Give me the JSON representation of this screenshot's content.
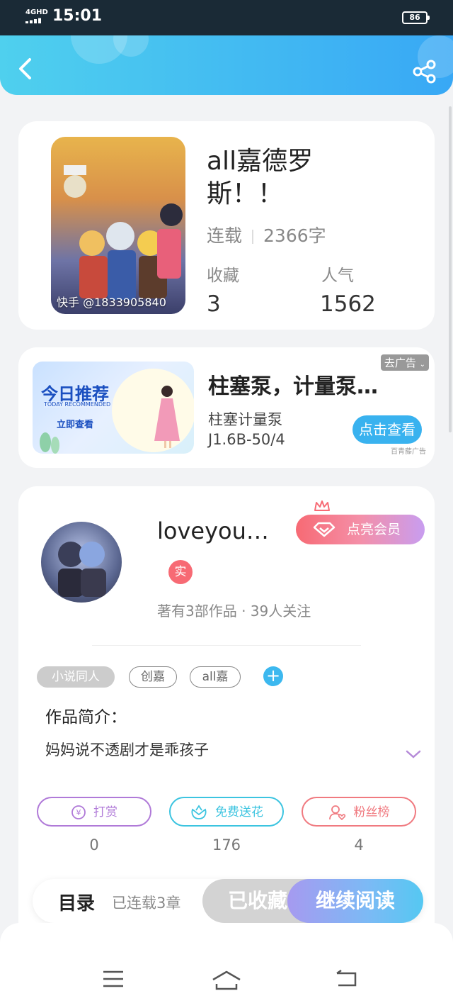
{
  "status_bar": {
    "network": "4GHD",
    "time": "15:01",
    "battery": "86"
  },
  "book": {
    "title": "all嘉德罗斯！！",
    "status": "连载",
    "word_count": "2366字",
    "favorites_label": "收藏",
    "favorites": "3",
    "popularity_label": "人气",
    "popularity": "1562",
    "cover_watermark": "快手 @1833905840"
  },
  "ad": {
    "title": "柱塞泵，计量泵…",
    "subtitle_line1": "柱塞计量泵",
    "subtitle_line2": "J1.6B-50/4",
    "button": "点击查看",
    "flag": "去广告",
    "source": "百青藤广告",
    "image_title": "今日推荐",
    "image_subtitle": "TODAY RECOMMENDED",
    "image_cta": "立即查看"
  },
  "author": {
    "name": "loveyou…",
    "vip_button": "点亮会员",
    "real_badge": "实",
    "stats": "著有3部作品 · 39人关注"
  },
  "tags": {
    "category": "小说同人",
    "items": [
      "创嘉",
      "all嘉"
    ]
  },
  "intro": {
    "label": "作品简介：",
    "text": "妈妈说不透剧才是乖孩子"
  },
  "actions": [
    {
      "label": "打赏",
      "count": "0",
      "color": "#b07ad8"
    },
    {
      "label": "免费送花",
      "count": "176",
      "color": "#3cc4e0"
    },
    {
      "label": "粉丝榜",
      "count": "4",
      "color": "#f07a80"
    }
  ],
  "bottom_bar": {
    "toc": "目录",
    "chapters": "已连载3章",
    "collected": "已收藏",
    "continue": "继续阅读"
  },
  "colors": {
    "header_start": "#4fd0ee",
    "header_end": "#38a8f5",
    "accent": "#39b2ef",
    "vip": "#f76a74"
  }
}
